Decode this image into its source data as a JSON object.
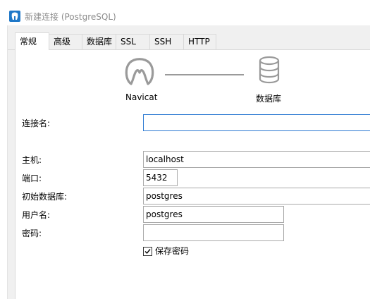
{
  "window": {
    "title": "新建连接 (PostgreSQL)"
  },
  "tabs": [
    {
      "label": "常规",
      "active": true
    },
    {
      "label": "高级",
      "active": false
    },
    {
      "label": "数据库",
      "active": false
    },
    {
      "label": "SSL",
      "active": false
    },
    {
      "label": "SSH",
      "active": false
    },
    {
      "label": "HTTP",
      "active": false
    }
  ],
  "diagram": {
    "left_label": "Navicat",
    "left_icon": "navicat-logo-icon",
    "right_label": "数据库",
    "right_icon": "database-icon"
  },
  "form": {
    "connection_name": {
      "label": "连接名:",
      "value": ""
    },
    "host": {
      "label": "主机:",
      "value": "localhost"
    },
    "port": {
      "label": "端口:",
      "value": "5432"
    },
    "initial_db": {
      "label": "初始数据库:",
      "value": "postgres"
    },
    "username": {
      "label": "用户名:",
      "value": "postgres"
    },
    "password": {
      "label": "密码:",
      "value": ""
    },
    "save_password": {
      "label": "保存密码",
      "checked": true
    }
  },
  "colors": {
    "focus_border": "#2b79d2",
    "dialog_bg": "#f0f0f0",
    "icon_gray": "#9a9a9a"
  }
}
